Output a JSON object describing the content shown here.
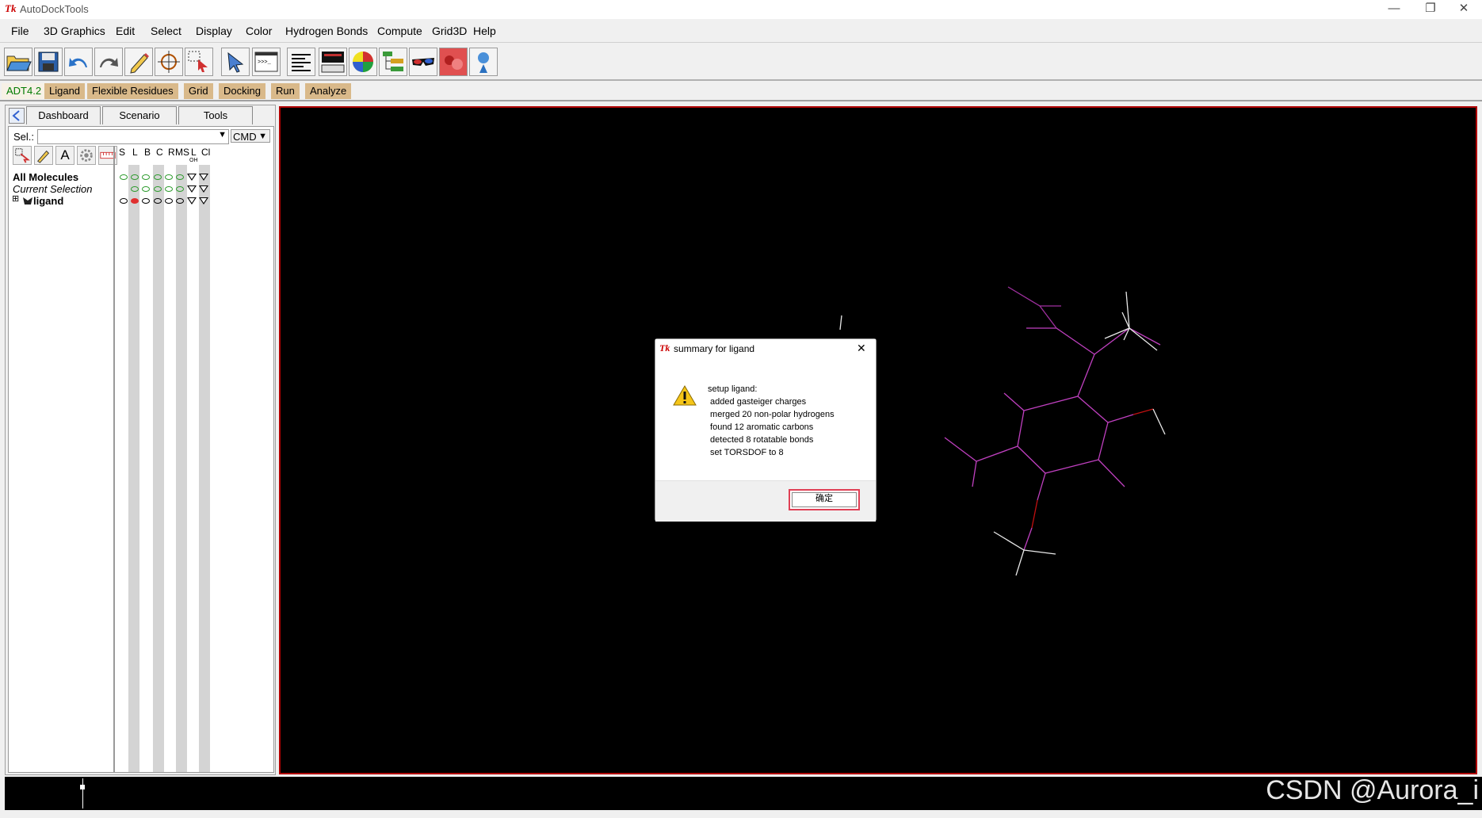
{
  "app": {
    "title": "AutoDockTools",
    "tk_logo": "Tk"
  },
  "window_controls": {
    "minimize": "—",
    "restore": "❐",
    "close": "✕"
  },
  "menubar": {
    "items": [
      "File",
      "3D Graphics",
      "Edit",
      "Select",
      "Display",
      "Color",
      "Hydrogen Bonds",
      "Compute",
      "Grid3D",
      "Help"
    ]
  },
  "toolbar": {
    "icons": [
      "open-file-icon",
      "save-icon",
      "undo-icon",
      "redo-icon",
      "pencil-icon",
      "crosshair-icon",
      "selection-icon",
      "pick-icon",
      "python-shell-icon",
      "text-align-icon",
      "monitor-icon",
      "color-sphere-icon",
      "tree-icon",
      "stereo-glasses-icon",
      "molecule-red-icon",
      "hbond-icon"
    ],
    "shell_prompt": ">>>_"
  },
  "adt_bar": {
    "version": "ADT4.2",
    "menus": [
      "Ligand",
      "Flexible Residues",
      "Grid",
      "Docking",
      "Run",
      "Analyze"
    ]
  },
  "dashboard": {
    "tabs": [
      "Dashboard",
      "Scenario",
      "Tools"
    ],
    "sel_label": "Sel.:",
    "sel_value": "",
    "cmd_label": "CMD",
    "column_headers": [
      "S",
      "L",
      "B",
      "C",
      "R",
      "MS",
      "L",
      "Cl"
    ],
    "column_sublabels": [
      "",
      "",
      "",
      "",
      "",
      "",
      "OH",
      ""
    ],
    "tree": [
      {
        "label": "All Molecules",
        "style": "bold"
      },
      {
        "label": "Current Selection",
        "style": "italic"
      },
      {
        "label": "ligand",
        "style": "bold",
        "expander": "⊞"
      }
    ]
  },
  "dialog": {
    "title": "summary for ligand",
    "close_glyph": "✕",
    "message": "setup ligand:\n added gasteiger charges\n merged 20 non-polar hydrogens\n found 12 aromatic carbons\n detected 8 rotatable bonds\n set TORSDOF to 8",
    "ok_label": "确定",
    "icon": "warning-icon"
  },
  "watermark": "CSDN @Aurora_i",
  "colors": {
    "viewer_bg": "#000000",
    "viewer_border": "#b00000",
    "bond_magenta": "#c040c0",
    "bond_white": "#e8e8e8",
    "bond_red": "#c01010",
    "adt_bar": "#d9b98a",
    "ok_highlight": "#e04055"
  }
}
